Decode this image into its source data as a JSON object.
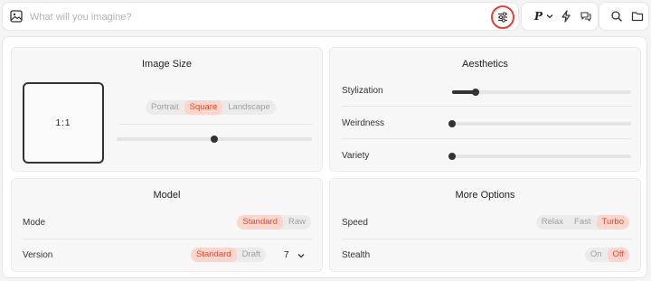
{
  "prompt": {
    "placeholder": "What will you imagine?",
    "value": ""
  },
  "toolbar": {
    "personalize_label": "P"
  },
  "image_size": {
    "title": "Image Size",
    "ratio_label": "1:1",
    "orientation_options": [
      "Portrait",
      "Square",
      "Landscape"
    ],
    "orientation_selected": "Square",
    "slider_level": 0.5
  },
  "aesthetics": {
    "title": "Aesthetics",
    "sliders": [
      {
        "label": "Stylization",
        "level": 0.13
      },
      {
        "label": "Weirdness",
        "level": 0.0
      },
      {
        "label": "Variety",
        "level": 0.0
      }
    ]
  },
  "model": {
    "title": "Model",
    "mode_label": "Mode",
    "mode_options": [
      "Standard",
      "Raw"
    ],
    "mode_selected": "Standard",
    "version_label": "Version",
    "version_options": [
      "Standard",
      "Draft"
    ],
    "version_selected": "Standard",
    "version_number": "7"
  },
  "more_options": {
    "title": "More Options",
    "speed_label": "Speed",
    "speed_options": [
      "Relax",
      "Fast",
      "Turbo"
    ],
    "speed_selected": "Turbo",
    "stealth_label": "Stealth",
    "stealth_options": [
      "On",
      "Off"
    ],
    "stealth_selected": "Off"
  },
  "colors": {
    "accent": "#e8402e",
    "accent_bg": "#fcd6cc",
    "ink": "#333333"
  },
  "icons": [
    "image-icon",
    "sliders-icon",
    "chevron-down-icon",
    "lightning-icon",
    "chat-icon",
    "search-icon",
    "folder-icon"
  ]
}
